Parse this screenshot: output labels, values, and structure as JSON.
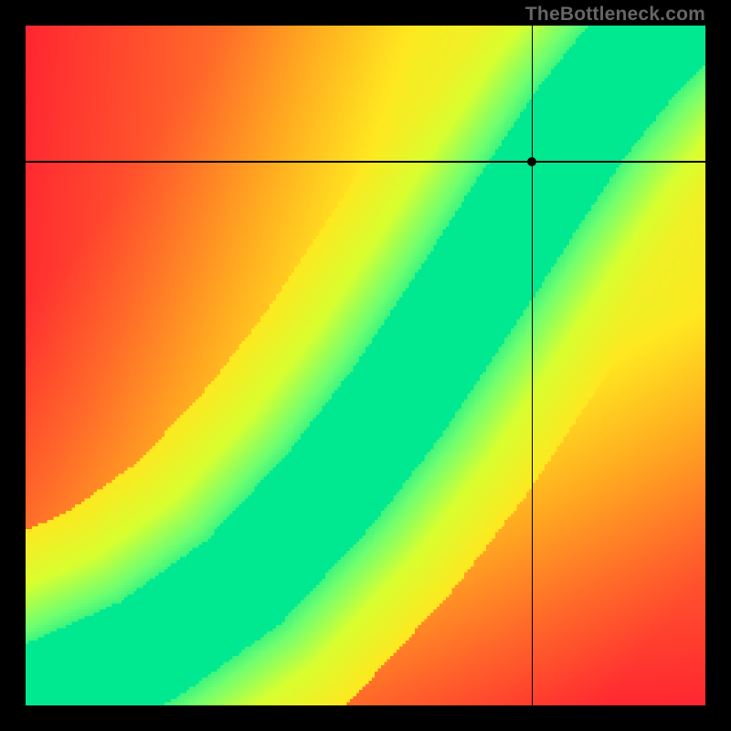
{
  "watermark": "TheBottleneck.com",
  "chart_data": {
    "type": "heatmap",
    "title": "",
    "xlabel": "",
    "ylabel": "",
    "xlim": [
      0,
      1
    ],
    "ylim": [
      0,
      1
    ],
    "description": "Bottleneck compatibility heatmap. Green curved ridge indicates balanced pairing; red regions indicate bottleneck. Crosshair marks a selected (x,y) point.",
    "colormap": {
      "stops": [
        {
          "t": 0.0,
          "color": "#ff1a33"
        },
        {
          "t": 0.25,
          "color": "#ff6a2a"
        },
        {
          "t": 0.45,
          "color": "#ffb020"
        },
        {
          "t": 0.62,
          "color": "#ffe820"
        },
        {
          "t": 0.78,
          "color": "#d8ff30"
        },
        {
          "t": 0.9,
          "color": "#70ff70"
        },
        {
          "t": 1.0,
          "color": "#00e890"
        }
      ]
    },
    "ridge": {
      "comment": "Green ridge path as (x, y) control points in [0,1]² plot coords, y measured from bottom.",
      "points": [
        [
          0.0,
          0.0
        ],
        [
          0.18,
          0.08
        ],
        [
          0.32,
          0.18
        ],
        [
          0.45,
          0.32
        ],
        [
          0.55,
          0.45
        ],
        [
          0.65,
          0.6
        ],
        [
          0.74,
          0.74
        ],
        [
          0.82,
          0.86
        ],
        [
          0.9,
          0.96
        ],
        [
          0.94,
          1.0
        ]
      ],
      "width": 0.055,
      "softness": 0.18
    },
    "crosshair": {
      "x": 0.745,
      "y": 0.8
    },
    "marker": {
      "x": 0.745,
      "y": 0.8,
      "radius_px": 5
    }
  },
  "layout": {
    "image_size": 800,
    "plot_inset": 28,
    "heatmap_resolution": 220
  }
}
